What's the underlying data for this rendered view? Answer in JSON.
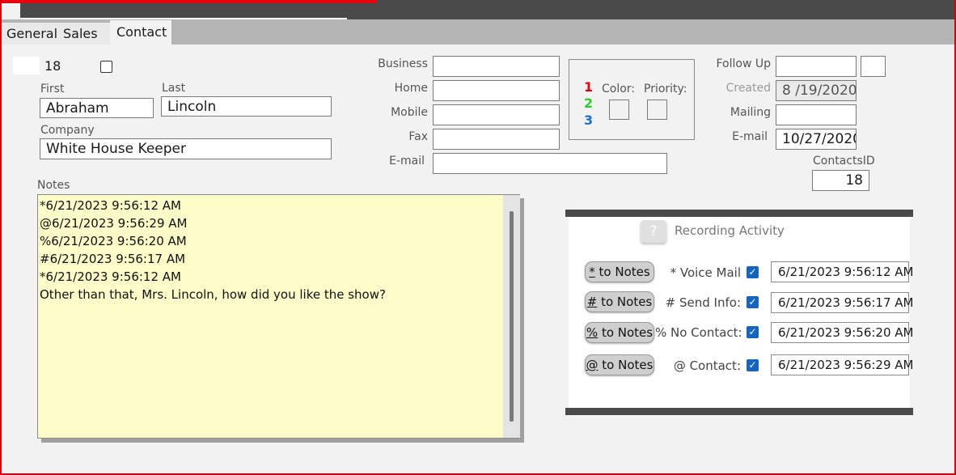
{
  "tabs": [
    "General",
    "Sales",
    "Contact"
  ],
  "record": {
    "number": "18"
  },
  "name": {
    "first_label": "First",
    "first_value": "Abraham",
    "last_label": "Last",
    "last_value": "Lincoln"
  },
  "company": {
    "label": "Company",
    "value": "White House Keeper"
  },
  "phones": {
    "business_label": "Business",
    "business_value": "",
    "home_label": "Home",
    "home_value": "",
    "mobile_label": "Mobile",
    "mobile_value": "",
    "fax_label": "Fax",
    "fax_value": "",
    "email_label": "E-mail",
    "email_value": ""
  },
  "priority_panel": {
    "numbers": [
      "1",
      "2",
      "3"
    ],
    "number_colors": [
      "#e8000d",
      "#2ecc2e",
      "#1a6fd0"
    ],
    "color_label": "Color:",
    "priority_label": "Priority:"
  },
  "right_fields": {
    "followup_label": "Follow Up",
    "followup_value": "",
    "created_label": "Created",
    "created_value": "8 /19/2020",
    "mailing_label": "Mailing",
    "mailing_value": "",
    "email_label": "E-mail",
    "email_value": "10/27/2020",
    "contactsid_label": "ContactsID",
    "contactsid_value": "18"
  },
  "notes": {
    "label": "Notes",
    "lines": [
      "*6/21/2023 9:56:12 AM",
      "@6/21/2023 9:56:29 AM",
      "%6/21/2023 9:56:20 AM",
      "#6/21/2023 9:56:17 AM",
      "*6/21/2023 9:56:12 AM",
      "Other than that, Mrs. Lincoln, how did you like the show?"
    ]
  },
  "recording": {
    "help_glyph": "?",
    "title": "Recording Activity",
    "rows": [
      {
        "button_symbol": "*",
        "button_rest": " to Notes",
        "label": "* Voice Mail",
        "checked": true,
        "time": "6/21/2023 9:56:12 AM"
      },
      {
        "button_symbol": "#",
        "button_rest": " to Notes",
        "label": "# Send Info:",
        "checked": true,
        "time": "6/21/2023 9:56:17 AM"
      },
      {
        "button_symbol": "%",
        "button_rest": " to Notes",
        "label": "% No Contact:",
        "checked": true,
        "time": "6/21/2023 9:56:20 AM"
      },
      {
        "button_symbol": "@",
        "button_rest": " to Notes",
        "label": "@ Contact:",
        "checked": true,
        "time": "6/21/2023 9:56:29 AM"
      }
    ]
  }
}
